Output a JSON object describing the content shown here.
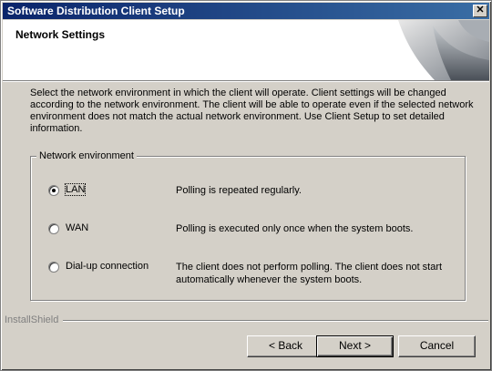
{
  "window": {
    "title": "Software Distribution Client Setup",
    "close_glyph": "✕"
  },
  "banner": {
    "title": "Network Settings"
  },
  "description": "Select the network environment in which the client will operate. Client settings will be changed according to the network environment. The client will be able to operate even if the selected network environment does not match the actual network environment. Use Client Setup to set detailed information.",
  "group": {
    "legend": "Network environment",
    "options": [
      {
        "label": "LAN",
        "description": "Polling is repeated regularly.",
        "selected": true
      },
      {
        "label": "WAN",
        "description": "Polling is executed only once when the system boots.",
        "selected": false
      },
      {
        "label": "Dial-up connection",
        "description": "The client does not perform polling. The client does not start automatically whenever the system boots.",
        "selected": false
      }
    ]
  },
  "footer": {
    "brand": "InstallShield",
    "back_label": "< Back",
    "next_label": "Next >",
    "cancel_label": "Cancel"
  },
  "colors": {
    "titlebar_start": "#0a246a",
    "titlebar_end": "#3a6ea5",
    "dialog_bg": "#d4d0c8"
  },
  "icons": {
    "close": "close-icon",
    "banner": "banner-graphic-icon"
  }
}
